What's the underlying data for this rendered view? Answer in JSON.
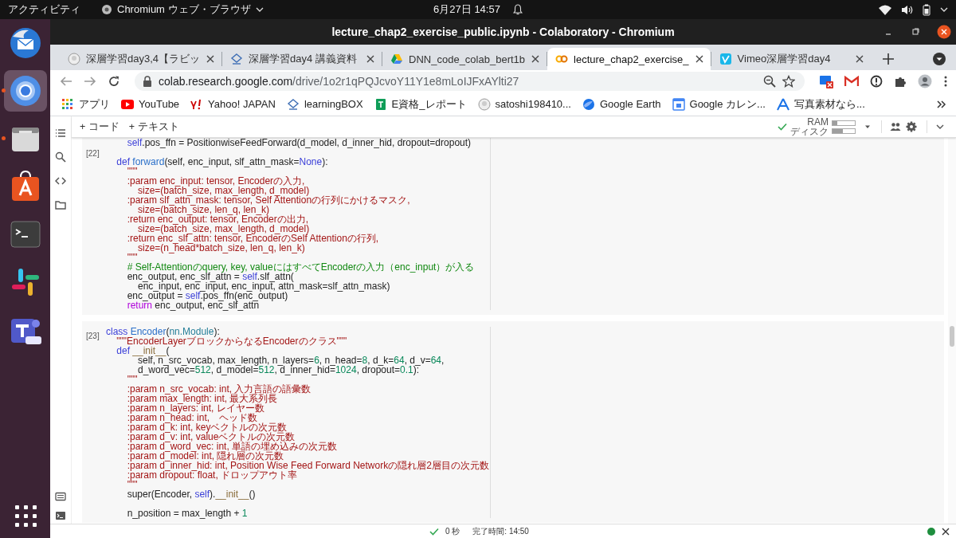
{
  "top_bar": {
    "activities": "アクティビティ",
    "app_menu": "Chromium ウェブ・ブラウザ",
    "clock": "6月27日 14:57"
  },
  "dock": [
    {
      "running": false,
      "selected": false
    },
    {
      "running": true,
      "selected": true
    },
    {
      "running": true,
      "selected": false
    },
    {
      "running": false,
      "selected": false
    },
    {
      "running": false,
      "selected": false
    },
    {
      "running": false,
      "selected": false
    },
    {
      "running": false,
      "selected": false
    },
    {
      "running": false,
      "selected": false
    }
  ],
  "window": {
    "title": "lecture_chap2_exercise_public.ipynb - Colaboratory - Chromium"
  },
  "tabs": [
    {
      "title": "深層学習day3,4【ラビッ",
      "selected": false
    },
    {
      "title": "深層学習day4 講義資料",
      "selected": false
    },
    {
      "title": "DNN_code_colab_bert1b",
      "selected": false
    },
    {
      "title": "lecture_chap2_exercise_",
      "selected": true
    },
    {
      "title": "Vimeo深層学習day4",
      "selected": false
    }
  ],
  "address_bar": {
    "host": "colab.research.google.com",
    "path": "/drive/1o2r1qPQJcvoY11Y1e8mLoIJFxAYlti27"
  },
  "bookmarks": [
    {
      "label": "アプリ"
    },
    {
      "label": "YouTube"
    },
    {
      "label": "Yahoo! JAPAN"
    },
    {
      "label": "learningBOX"
    },
    {
      "label": "E資格_レポート"
    },
    {
      "label": "satoshi198410..."
    },
    {
      "label": "Google Earth"
    },
    {
      "label": "Google カレン..."
    },
    {
      "label": "写真素材なら..."
    }
  ],
  "colab": {
    "toolbar": {
      "add_code": "+ コード",
      "add_text": "+ テキスト",
      "ram": {
        "label": "RAM",
        "level": 0.2
      },
      "disk": {
        "label": "ディスク",
        "level": 0.45
      }
    },
    "cells": [
      {
        "count": "[22]",
        "lines": [
          {
            "kind": "code",
            "segments": [
              {
                "kind": "self",
                "text": "        self"
              },
              {
                "kind": "plain",
                "text": ".pos_ffn = PositionwiseFeedForward(d_model, d_inner_hid, dropout=dropout)"
              }
            ]
          },
          {
            "kind": "blank"
          },
          {
            "kind": "code",
            "segments": [
              {
                "kind": "keyword",
                "text": "    def "
              },
              {
                "kind": "name",
                "text": "forward"
              },
              {
                "kind": "plain",
                "text": "(self, enc_input, slf_attn_mask="
              },
              {
                "kind": "keyword",
                "text": "None"
              },
              {
                "kind": "plain",
                "text": "):"
              }
            ]
          },
          {
            "kind": "code",
            "segments": [
              {
                "kind": "string",
                "text": "        \"\"\""
              }
            ]
          },
          {
            "kind": "code",
            "segments": [
              {
                "kind": "string",
                "text": "        :param enc_input: tensor, Encoderの入力,"
              }
            ]
          },
          {
            "kind": "code",
            "segments": [
              {
                "kind": "string",
                "text": "            size=(batch_size, max_length, d_model)"
              }
            ]
          },
          {
            "kind": "code",
            "segments": [
              {
                "kind": "string",
                "text": "        :param slf_attn_mask: tensor, Self Attentionの行列にかけるマスク,"
              }
            ]
          },
          {
            "kind": "code",
            "segments": [
              {
                "kind": "string",
                "text": "            size=(batch_size, len_q, len_k)"
              }
            ]
          },
          {
            "kind": "code",
            "segments": [
              {
                "kind": "string",
                "text": "        :return enc_output: tensor, Encoderの出力,"
              }
            ]
          },
          {
            "kind": "code",
            "segments": [
              {
                "kind": "string",
                "text": "            size=(batch_size, max_length, d_model)"
              }
            ]
          },
          {
            "kind": "code",
            "segments": [
              {
                "kind": "string",
                "text": "        :return enc_slf_attn: tensor, EncoderのSelf Attentionの行列,"
              }
            ]
          },
          {
            "kind": "code",
            "segments": [
              {
                "kind": "string",
                "text": "            size=(n_head*batch_size, len_q, len_k)"
              }
            ]
          },
          {
            "kind": "code",
            "segments": [
              {
                "kind": "string",
                "text": "        \"\"\""
              }
            ]
          },
          {
            "kind": "code",
            "segments": [
              {
                "kind": "comment",
                "text": "        # Self-Attentionのquery, key, valueにはすべてEncoderの入力（enc_input）が入る"
              }
            ]
          },
          {
            "kind": "code",
            "segments": [
              {
                "kind": "plain",
                "text": "        enc_output, enc_slf_attn = "
              },
              {
                "kind": "self",
                "text": "self"
              },
              {
                "kind": "plain",
                "text": ".slf_attn("
              }
            ]
          },
          {
            "kind": "code",
            "segments": [
              {
                "kind": "plain",
                "text": "            enc_input, enc_input, enc_input, attn_mask=slf_attn_mask)"
              }
            ]
          },
          {
            "kind": "code",
            "segments": [
              {
                "kind": "plain",
                "text": "        enc_output = "
              },
              {
                "kind": "self",
                "text": "self"
              },
              {
                "kind": "plain",
                "text": ".pos_ffn(enc_output)"
              }
            ]
          },
          {
            "kind": "code",
            "segments": [
              {
                "kind": "control",
                "text": "        return"
              },
              {
                "kind": "plain",
                "text": " enc_output, enc_slf_attn"
              }
            ]
          }
        ]
      },
      {
        "count": "[23]",
        "lines": [
          {
            "kind": "code",
            "segments": [
              {
                "kind": "keyword",
                "text": "class "
              },
              {
                "kind": "name",
                "text": "Encoder"
              },
              {
                "kind": "plain",
                "text": "("
              },
              {
                "kind": "type",
                "text": "nn.Module"
              },
              {
                "kind": "plain",
                "text": "):"
              }
            ]
          },
          {
            "kind": "code",
            "segments": [
              {
                "kind": "string",
                "text": "    \"\"\"EncoderLayerブロックからなるEncoderのクラス\"\"\""
              }
            ]
          },
          {
            "kind": "code",
            "segments": [
              {
                "kind": "keyword",
                "text": "    def "
              },
              {
                "kind": "magic",
                "text": "__init__"
              },
              {
                "kind": "plain",
                "text": "("
              }
            ]
          },
          {
            "kind": "code",
            "segments": [
              {
                "kind": "plain",
                "text": "            self, n_src_vocab, max_length, n_layers="
              },
              {
                "kind": "number",
                "text": "6"
              },
              {
                "kind": "plain",
                "text": ", n_head="
              },
              {
                "kind": "number",
                "text": "8"
              },
              {
                "kind": "plain",
                "text": ", d_k="
              },
              {
                "kind": "number",
                "text": "64"
              },
              {
                "kind": "plain",
                "text": ", d_v="
              },
              {
                "kind": "number",
                "text": "64"
              },
              {
                "kind": "plain",
                "text": ","
              }
            ]
          },
          {
            "kind": "code",
            "segments": [
              {
                "kind": "plain",
                "text": "            d_word_vec="
              },
              {
                "kind": "number",
                "text": "512"
              },
              {
                "kind": "plain",
                "text": ", d_model="
              },
              {
                "kind": "number",
                "text": "512"
              },
              {
                "kind": "plain",
                "text": ", d_inner_hid="
              },
              {
                "kind": "number",
                "text": "1024"
              },
              {
                "kind": "plain",
                "text": ", dropout="
              },
              {
                "kind": "number",
                "text": "0.1"
              },
              {
                "kind": "plain",
                "text": "):"
              }
            ]
          },
          {
            "kind": "code",
            "segments": [
              {
                "kind": "string",
                "text": "        \"\"\""
              }
            ]
          },
          {
            "kind": "code",
            "segments": [
              {
                "kind": "string",
                "text": "        :param n_src_vocab: int, 入力言語の語彙数"
              }
            ]
          },
          {
            "kind": "code",
            "segments": [
              {
                "kind": "string",
                "text": "        :param max_length: int, 最大系列長"
              }
            ]
          },
          {
            "kind": "code",
            "segments": [
              {
                "kind": "string",
                "text": "        :param n_layers: int, レイヤー数"
              }
            ]
          },
          {
            "kind": "code",
            "segments": [
              {
                "kind": "string",
                "text": "        :param n_head: int,　ヘッド数"
              }
            ]
          },
          {
            "kind": "code",
            "segments": [
              {
                "kind": "string",
                "text": "        :param d_k: int, keyベクトルの次元数"
              }
            ]
          },
          {
            "kind": "code",
            "segments": [
              {
                "kind": "string",
                "text": "        :param d_v: int, valueベクトルの次元数"
              }
            ]
          },
          {
            "kind": "code",
            "segments": [
              {
                "kind": "string",
                "text": "        :param d_word_vec: int, 単語の埋め込みの次元数"
              }
            ]
          },
          {
            "kind": "code",
            "segments": [
              {
                "kind": "string",
                "text": "        :param d_model: int, 隠れ層の次元数"
              }
            ]
          },
          {
            "kind": "code",
            "segments": [
              {
                "kind": "string",
                "text": "        :param d_inner_hid: int, Position Wise Feed Forward Networkの隠れ層2層目の次元数"
              }
            ]
          },
          {
            "kind": "code",
            "segments": [
              {
                "kind": "string",
                "text": "        :param dropout: float, ドロップアウト率"
              }
            ]
          },
          {
            "kind": "code",
            "segments": [
              {
                "kind": "string",
                "text": "        \"\"\""
              }
            ]
          },
          {
            "kind": "code",
            "segments": [
              {
                "kind": "plain",
                "text": "        super(Encoder, "
              },
              {
                "kind": "self",
                "text": "self"
              },
              {
                "kind": "plain",
                "text": ")."
              },
              {
                "kind": "magic",
                "text": "__init__"
              },
              {
                "kind": "plain",
                "text": "()"
              }
            ]
          },
          {
            "kind": "blank"
          },
          {
            "kind": "code",
            "segments": [
              {
                "kind": "plain",
                "text": "        n_position = max_length + "
              },
              {
                "kind": "number",
                "text": "1"
              }
            ]
          }
        ]
      }
    ],
    "status": {
      "duration": "0 秒",
      "finished": "完了時間: 14:50"
    }
  }
}
